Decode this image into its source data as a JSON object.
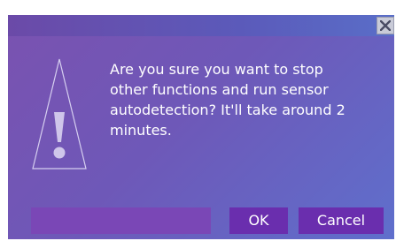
{
  "dialog": {
    "close_label": "X",
    "message": "Are you sure you want to stop\nother functions and run sensor\nautodetection? It'll take around 2\nminutes.",
    "progress": 0,
    "ok_label": "OK",
    "cancel_label": "Cancel"
  },
  "icons": {
    "warning": "warning-triangle-icon",
    "close": "close-icon"
  },
  "colors": {
    "dialog_gradient_start": "#7a52b0",
    "dialog_gradient_end": "#5f6fcc",
    "button_bg": "#6a2eae",
    "progress_track": "#7a47b6",
    "text": "#ffffff",
    "close_button_bg": "#c9cbd8"
  }
}
